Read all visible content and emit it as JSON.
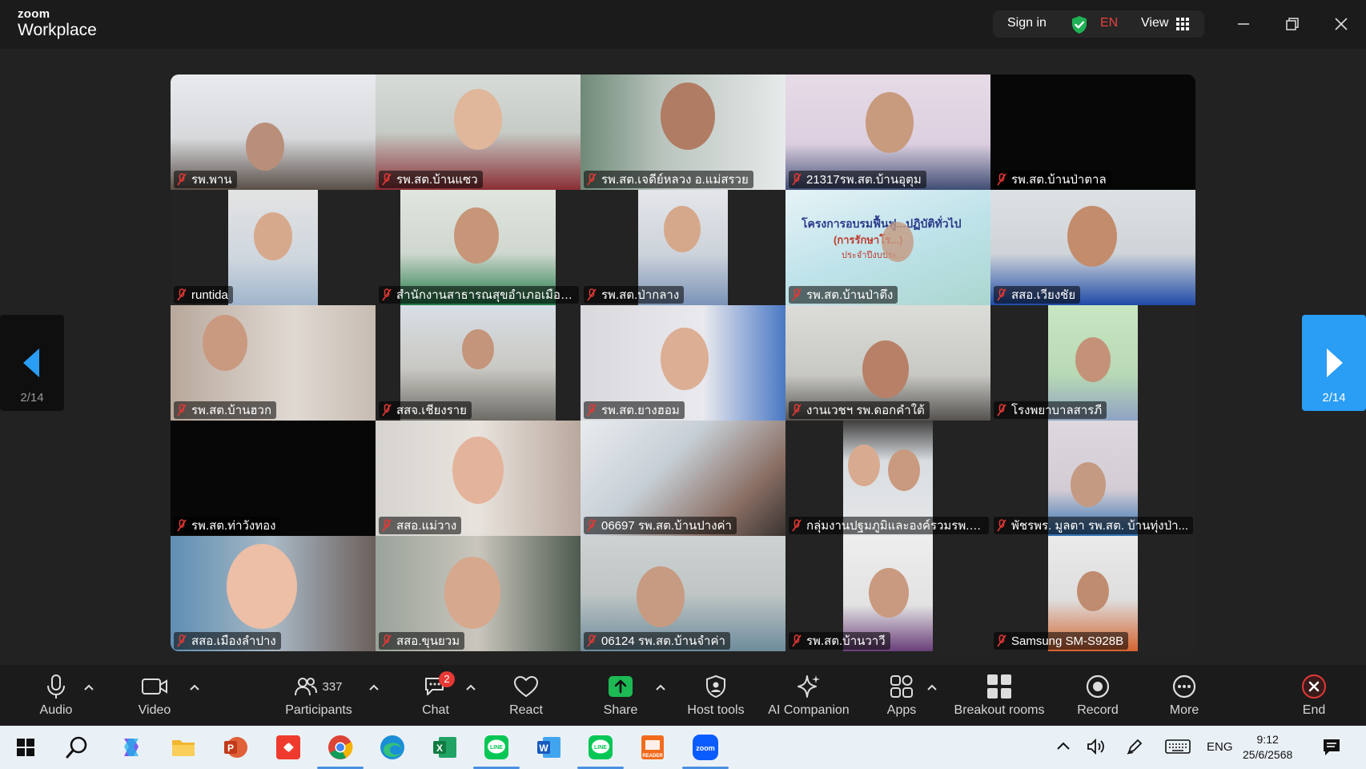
{
  "window": {
    "brand_small": "zoom",
    "brand_main": "Workplace",
    "sign_in": "Sign in",
    "language": "EN",
    "view": "View",
    "colors": {
      "shield": "#1fb155",
      "lang": "#e8423f"
    }
  },
  "gallery": {
    "page_indicator": "2/14",
    "tiles": [
      {
        "name": "รพ.พาน"
      },
      {
        "name": "รพ.สต.บ้านแซว"
      },
      {
        "name": "รพ.สต.เจดีย์หลวง  อ.แม่สรวย"
      },
      {
        "name": "21317รพ.สต.บ้านอุตุม"
      },
      {
        "name": "รพ.สต.บ้านป่าตาล"
      },
      {
        "name": "runtida"
      },
      {
        "name": "สำนักงานสาธารณสุขอำเภอเมืองแ..."
      },
      {
        "name": "รพ.สต.ป่ากลาง"
      },
      {
        "name": "รพ.สต.บ้านป่าตึง"
      },
      {
        "name": "สสอ.เวียงชัย"
      },
      {
        "name": "รพ.สต.บ้านฮวก"
      },
      {
        "name": "สสจ.เชียงราย"
      },
      {
        "name": "รพ.สต.ยางฮอม"
      },
      {
        "name": "งานเวชฯ รพ.ดอกคำใต้"
      },
      {
        "name": "โรงพยาบาลสารภี"
      },
      {
        "name": "รพ.สต.ท่าวังทอง"
      },
      {
        "name": "สสอ.แม่วาง"
      },
      {
        "name": "06697 รพ.สต.บ้านปางค่า"
      },
      {
        "name": "กลุ่มงานปฐมภูมิและองค์รวมรพ.เทิง"
      },
      {
        "name": "พัชรพร. มูลตา รพ.สต. บ้านทุ่งป่า..."
      },
      {
        "name": "สสอ.เมืองลำปาง"
      },
      {
        "name": "สสอ.ขุนยวม"
      },
      {
        "name": "06124 รพ.สต.บ้านจำค่า"
      },
      {
        "name": "รพ.สต.บ้านวาวี"
      },
      {
        "name": "Samsung SM-S928B"
      }
    ],
    "tile_text": {
      "banner_line1": "โครงการอบรมฟื้นฟู...ปฏิบัติทั่วไป",
      "banner_line2": "(การรักษาโร...)",
      "banner_line3": "ประจำปีงบประ..."
    }
  },
  "toolbar": {
    "audio": "Audio",
    "video": "Video",
    "participants": "Participants",
    "participants_count": "337",
    "chat": "Chat",
    "chat_badge": "2",
    "react": "React",
    "share": "Share",
    "host_tools": "Host tools",
    "ai_companion": "AI Companion",
    "apps": "Apps",
    "breakout_rooms": "Breakout rooms",
    "record": "Record",
    "more": "More",
    "end": "End",
    "colors": {
      "share": "#1db954",
      "end": "#e53935",
      "badge": "#e53935"
    }
  },
  "taskbar": {
    "apps": [
      "windows-start",
      "search",
      "copilot",
      "file-explorer",
      "powerpoint",
      "anydesk",
      "chrome",
      "edge",
      "excel",
      "line",
      "word",
      "line",
      "pdf-reader",
      "zoom"
    ],
    "lang": "ENG",
    "time": "9:12",
    "date": "25/6/2568"
  }
}
